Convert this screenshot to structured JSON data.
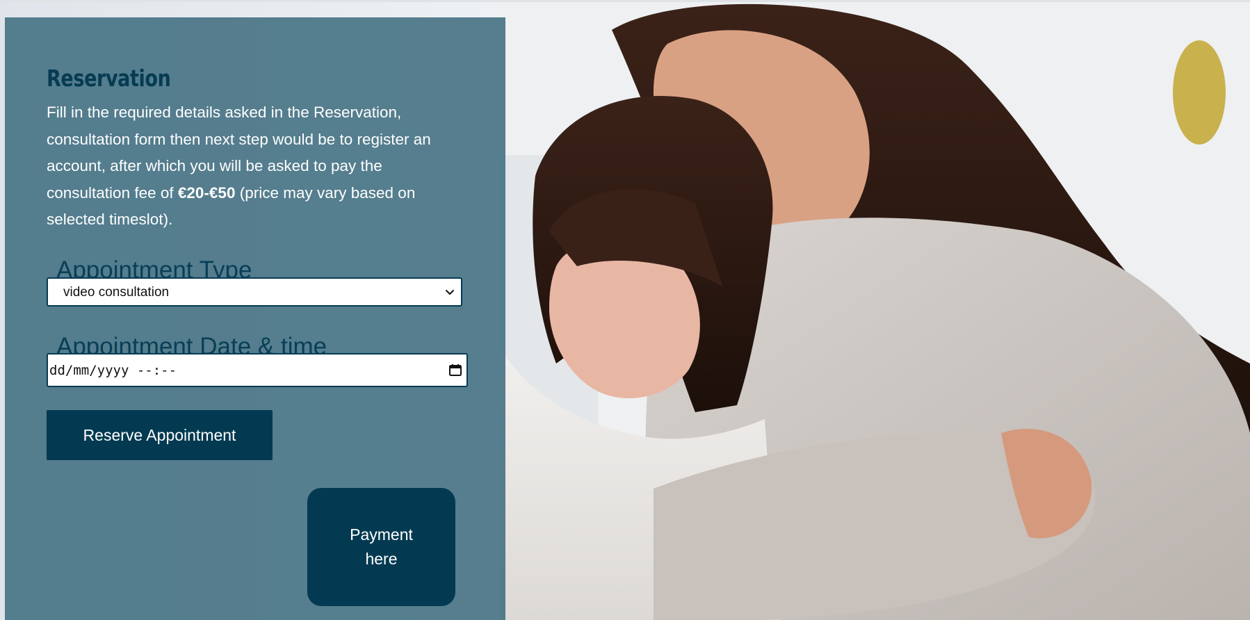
{
  "reservation": {
    "heading": "Reservation",
    "intro_before_price": "Fill in the required details asked in the Reservation, consultation form then next step would be to register an account, after which you will be asked to pay the consultation fee of ",
    "price": "€20-€50",
    "intro_after_price": " (price may vary based on selected timeslot)."
  },
  "form": {
    "appointment_type_label": "Appointment Type",
    "appointment_type_value": "video consultation",
    "appointment_datetime_label": "Appointment Date & time",
    "appointment_datetime_placeholder": "dd/mm/yyyy --:--",
    "reserve_button_label": "Reserve Appointment",
    "payment_button_label": "Payment here"
  },
  "icons": {
    "select": "chevron-down-icon",
    "date": "calendar-icon"
  },
  "colors": {
    "panel": "#3d6b7e",
    "brand_dark": "#033a52",
    "heading": "#063b52"
  }
}
